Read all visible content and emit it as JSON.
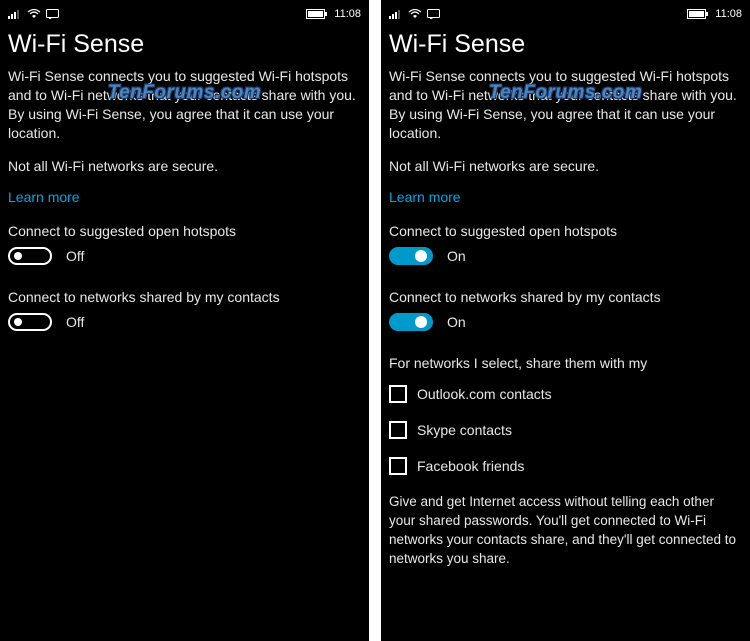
{
  "watermark": "TenForums.com",
  "statusBar": {
    "time": "11:08"
  },
  "left": {
    "title": "Wi-Fi Sense",
    "intro": "Wi-Fi Sense connects you to suggested Wi-Fi hotspots and to Wi-Fi networks that your contacts share with you. By using Wi-Fi Sense, you agree that it can use your location.",
    "secureNote": "Not all Wi-Fi networks are secure.",
    "learnMore": "Learn more",
    "hotspotsLabel": "Connect to suggested open hotspots",
    "hotspotsState": "Off",
    "contactsLabel": "Connect to networks shared by my contacts",
    "contactsState": "Off"
  },
  "right": {
    "title": "Wi-Fi Sense",
    "intro": "Wi-Fi Sense connects you to suggested Wi-Fi hotspots and to Wi-Fi networks that your contacts share with you. By using Wi-Fi Sense, you agree that it can use your location.",
    "secureNote": "Not all Wi-Fi networks are secure.",
    "learnMore": "Learn more",
    "hotspotsLabel": "Connect to suggested open hotspots",
    "hotspotsState": "On",
    "contactsLabel": "Connect to networks shared by my contacts",
    "contactsState": "On",
    "shareHeading": "For networks I select, share them with my",
    "shareOptions": {
      "outlook": "Outlook.com contacts",
      "skype": "Skype contacts",
      "facebook": "Facebook friends"
    },
    "infoText": "Give and get Internet access without telling each other your shared passwords. You'll get connected to Wi-Fi networks your contacts share, and they'll get connected to networks you share."
  }
}
